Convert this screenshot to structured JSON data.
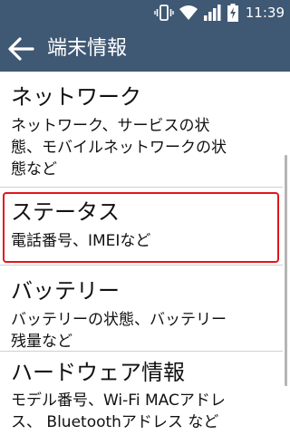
{
  "status_bar": {
    "time": "11:39",
    "icons": [
      "vibrate-icon",
      "wifi-icon",
      "signal-icon",
      "battery-charging-icon"
    ]
  },
  "app_bar": {
    "title": "端末情報",
    "back_icon": "arrow-back-icon"
  },
  "list": {
    "items": [
      {
        "title": "ネットワーク",
        "summary_lines": [
          "ネットワーク、サービスの状",
          "態、モバイルネットワークの状",
          "態など"
        ]
      },
      {
        "title": "ステータス",
        "summary_lines": [
          "電話番号、IMEIなど"
        ]
      },
      {
        "title": "バッテリー",
        "summary_lines": [
          "バッテリーの状態、バッテリー",
          "残量など"
        ]
      },
      {
        "title": "ハードウェア情報",
        "summary_lines": [
          "モデル番号、Wi-Fi MACアドレ",
          "ス、 Bluetoothアドレス など"
        ]
      }
    ]
  },
  "colors": {
    "bar_background": "#3f5874",
    "highlight": "#e3141b",
    "text": "#111111"
  }
}
